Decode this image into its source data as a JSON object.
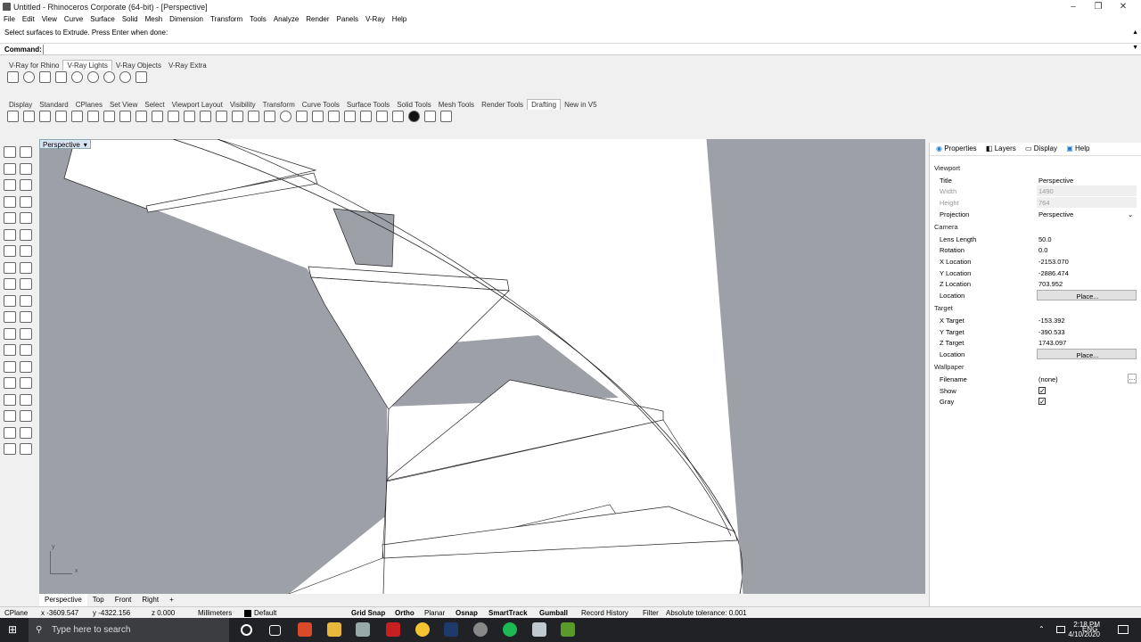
{
  "window": {
    "title": "Untitled - Rhinoceros Corporate (64-bit) - [Perspective]",
    "min": "–",
    "max": "❐",
    "close": "✕"
  },
  "menu": [
    "File",
    "Edit",
    "View",
    "Curve",
    "Surface",
    "Solid",
    "Mesh",
    "Dimension",
    "Transform",
    "Tools",
    "Analyze",
    "Render",
    "Panels",
    "V-Ray",
    "Help"
  ],
  "command_history": "Select surfaces to Extrude. Press Enter when done:",
  "command": {
    "label": "Command:",
    "value": ""
  },
  "vray_tabs": [
    "V-Ray for Rhino",
    "V-Ray Lights",
    "V-Ray Objects",
    "V-Ray Extra"
  ],
  "vray_active_tab": "V-Ray Lights",
  "tool_tabs": [
    "Display",
    "Standard",
    "CPlanes",
    "Set View",
    "Select",
    "Viewport Layout",
    "Visibility",
    "Transform",
    "Curve Tools",
    "Surface Tools",
    "Solid Tools",
    "Mesh Tools",
    "Render Tools",
    "Drafting",
    "New in V5"
  ],
  "tool_active_tab": "Drafting",
  "viewport": {
    "label": "Perspective",
    "axes": {
      "x": "x",
      "y": "y"
    }
  },
  "viewport_tabs": [
    "Perspective",
    "Top",
    "Front",
    "Right"
  ],
  "viewport_add": "+",
  "panel_tabs": [
    "Properties",
    "Layers",
    "Display",
    "Help"
  ],
  "properties": {
    "viewport_section": "Viewport",
    "title_k": "Title",
    "title_v": "Perspective",
    "width_k": "Width",
    "width_v": "1490",
    "height_k": "Height",
    "height_v": "764",
    "projection_k": "Projection",
    "projection_v": "Perspective",
    "camera_section": "Camera",
    "lens_k": "Lens Length",
    "lens_v": "50.0",
    "rotation_k": "Rotation",
    "rotation_v": "0.0",
    "xloc_k": "X Location",
    "xloc_v": "-2153.070",
    "yloc_k": "Y Location",
    "yloc_v": "-2886.474",
    "zloc_k": "Z Location",
    "zloc_v": "703.952",
    "loc_k": "Location",
    "place": "Place...",
    "target_section": "Target",
    "xt_k": "X Target",
    "xt_v": "-153.392",
    "yt_k": "Y Target",
    "yt_v": "-390.533",
    "zt_k": "Z Target",
    "zt_v": "1743.097",
    "wallpaper_section": "Wallpaper",
    "filename_k": "Filename",
    "filename_v": "(none)",
    "show_k": "Show",
    "gray_k": "Gray"
  },
  "status": {
    "cplane": "CPlane",
    "x": "x -3609.547",
    "y": "y -4322.156",
    "z": "z 0.000",
    "units": "Millimeters",
    "layer": "Default",
    "grid_snap": "Grid Snap",
    "ortho": "Ortho",
    "planar": "Planar",
    "osnap": "Osnap",
    "smarttrack": "SmartTrack",
    "gumball": "Gumball",
    "record": "Record History",
    "filter": "Filter",
    "tolerance": "Absolute tolerance: 0.001"
  },
  "taskbar": {
    "search": "Type here to search",
    "lang": "ENG",
    "time": "2:18 PM",
    "date": "4/10/2020"
  }
}
